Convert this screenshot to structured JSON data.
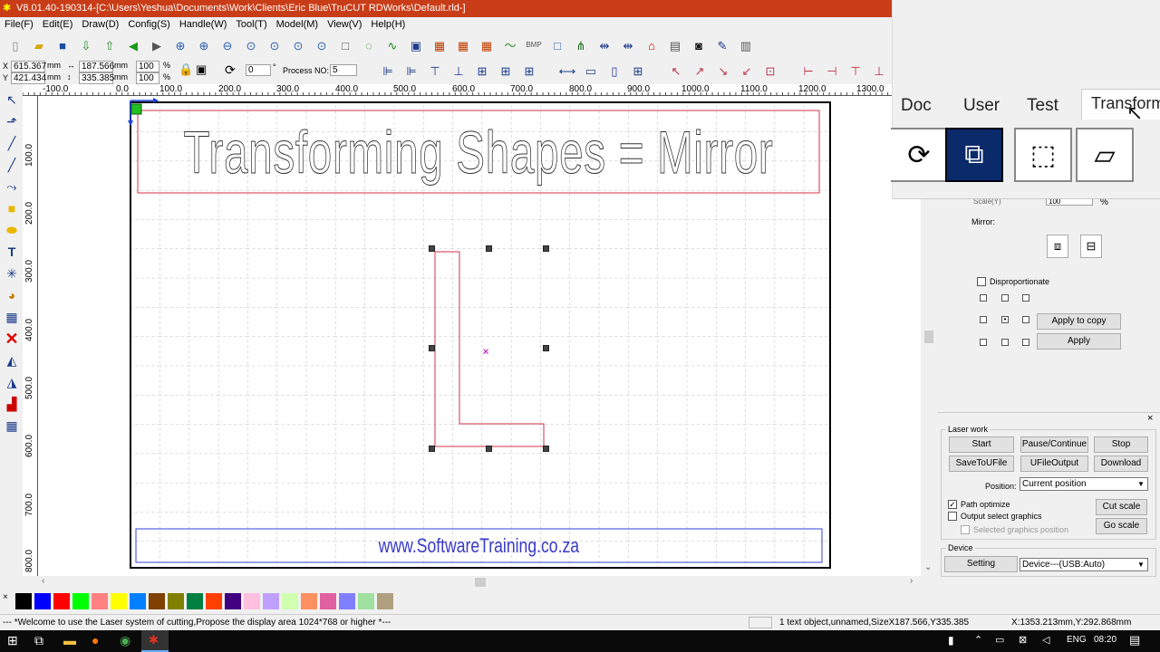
{
  "window": {
    "title": "V8.01.40-190314-[C:\\Users\\Yeshua\\Documents\\Work\\Clients\\Eric Blue\\TruCUT RDWorks\\Default.rld-]"
  },
  "menu": [
    "File(F)",
    "Edit(E)",
    "Draw(D)",
    "Config(S)",
    "Handle(W)",
    "Tool(T)",
    "Model(M)",
    "View(V)",
    "Help(H)"
  ],
  "props": {
    "x_label": "X",
    "x_value": "615.367",
    "y_label": "Y",
    "y_value": "421.434",
    "w_value": "187.566",
    "h_value": "335.385",
    "unit": "mm",
    "sx": "100",
    "sy": "100",
    "pct": "%",
    "angle": "0",
    "deg": "°",
    "process_label": "Process NO:",
    "process_value": "5"
  },
  "ruler_top": [
    "-100.0",
    "0.0",
    "100.0",
    "200.0",
    "300.0",
    "400.0",
    "500.0",
    "600.0",
    "700.0",
    "800.0",
    "900.0",
    "1000.0",
    "1100.0",
    "1200.0",
    "1300.0"
  ],
  "ruler_left": [
    "100.0",
    "200.0",
    "300.0",
    "400.0",
    "500.0",
    "600.0",
    "700.0",
    "800.0"
  ],
  "canvas": {
    "heading": "Transforming Shapes = Mirror",
    "footer": "www.SoftwareTraining.co.za"
  },
  "tabs": [
    "Doc",
    "User",
    "Test",
    "Transform"
  ],
  "transform": {
    "scale_label": "Scale(Y)",
    "scale_value": "100",
    "pct": "%",
    "mirror_label": "Mirror:",
    "disproportionate": "Disproportionate",
    "apply_copy": "Apply to copy",
    "apply": "Apply"
  },
  "laserwork": {
    "title": "Laser work",
    "start": "Start",
    "pause": "Pause/Continue",
    "stop": "Stop",
    "save_u": "SaveToUFile",
    "ufile_out": "UFileOutput",
    "download": "Download",
    "position_label": "Position:",
    "position_value": "Current position",
    "path_optimize": "Path optimize",
    "output_select": "Output select graphics",
    "selected_pos": "Selected graphics position",
    "cut_scale": "Cut scale",
    "go_scale": "Go scale"
  },
  "device": {
    "title": "Device",
    "setting": "Setting",
    "device_value": "Device---(USB:Auto)"
  },
  "palette": [
    "#000000",
    "#0000ff",
    "#ff0000",
    "#00ff00",
    "#ff8080",
    "#ffff00",
    "#0080ff",
    "#804000",
    "#808000",
    "#008040",
    "#ff4000",
    "#400080",
    "#ffc0e0",
    "#c0a0ff",
    "#d0ffb0",
    "#ff9060",
    "#e060a0",
    "#8080ff",
    "#a0e0a0",
    "#b0a080"
  ],
  "status": {
    "welcome": "--- *Welcome to use the Laser system of cutting,Propose the display area 1024*768 or higher *---",
    "selection": "1 text object,unnamed,SizeX187.566,Y335.385",
    "coords": "X:1353.213mm,Y:292.868mm"
  },
  "taskbar": {
    "lang": "ENG",
    "time": "08:20"
  }
}
